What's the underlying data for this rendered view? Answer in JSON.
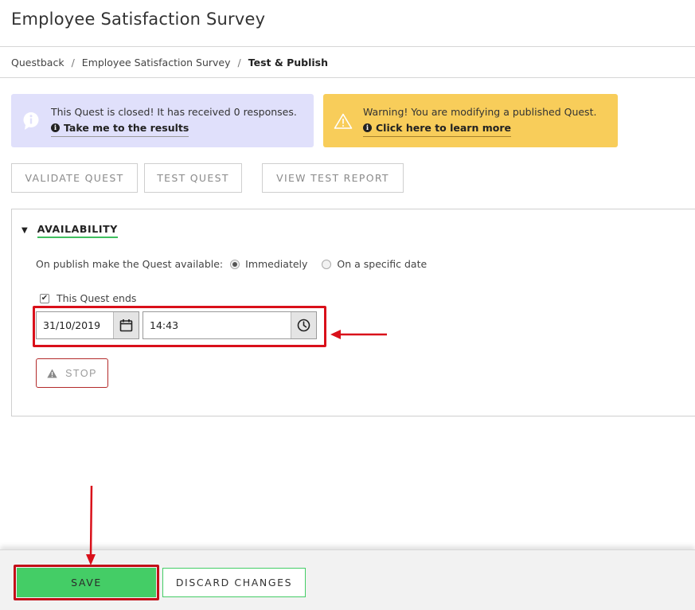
{
  "header": {
    "title": "Employee Satisfaction Survey"
  },
  "breadcrumb": {
    "items": [
      "Questback",
      "Employee Satisfaction Survey",
      "Test & Publish"
    ],
    "separator": "/"
  },
  "alerts": {
    "info": {
      "icon": "info-bubble-icon",
      "message": "This Quest is closed! It has received 0 responses.",
      "link": "Take me to the results",
      "color": "#e0e0fb"
    },
    "warning": {
      "icon": "warning-triangle-icon",
      "message": "Warning! You are modifying a published Quest.",
      "link": "Click here to learn more",
      "color": "#f8cd5a"
    }
  },
  "toolbar": {
    "validate_label": "VALIDATE QUEST",
    "test_label": "TEST QUEST",
    "report_label": "VIEW TEST REPORT"
  },
  "availability": {
    "title": "AVAILABILITY",
    "publish_label": "On publish make the Quest available:",
    "options": [
      {
        "label": "Immediately",
        "selected": true
      },
      {
        "label": "On a specific date",
        "selected": false
      }
    ],
    "ends": {
      "label": "This Quest ends",
      "checked": true
    },
    "end_date": "31/10/2019",
    "end_time": "14:43",
    "stop_label": "STOP"
  },
  "footer": {
    "save_label": "SAVE",
    "discard_label": "DISCARD CHANGES"
  },
  "colors": {
    "accent_green": "#44cd66",
    "annotation_red": "#d9101a",
    "stop_border": "#b32a2a"
  }
}
